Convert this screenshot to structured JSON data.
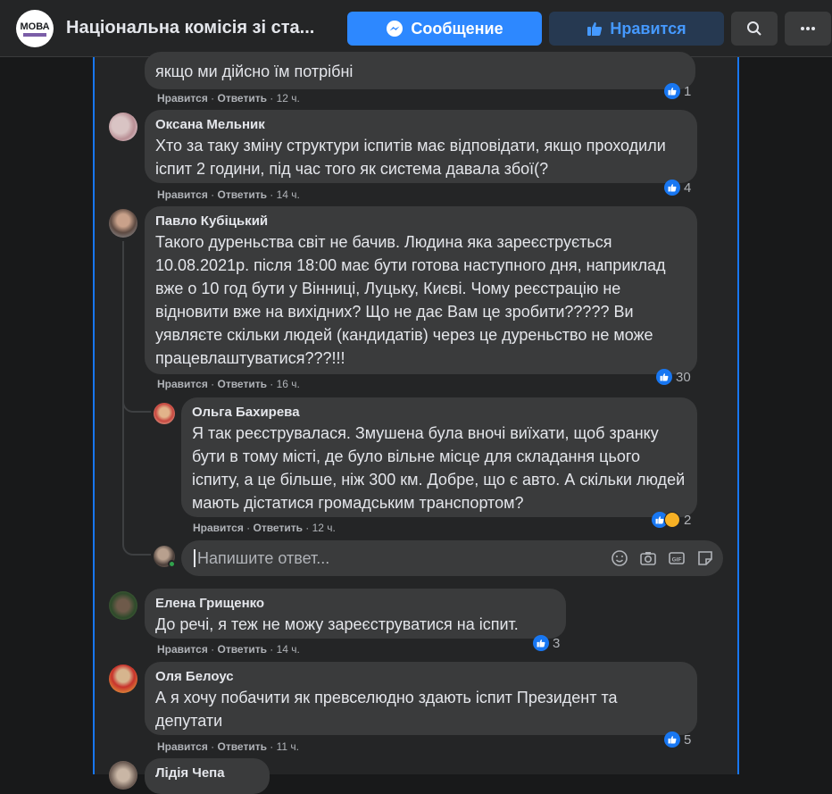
{
  "header": {
    "logo_text": "МОВА",
    "title": "Національна комісія зі ста...",
    "message_label": "Сообщение",
    "like_label": "Нравится"
  },
  "colors": {
    "accent": "#2d88ff",
    "bubble": "#3a3b3c",
    "background": "#242526"
  },
  "comments": [
    {
      "author": "",
      "text": "якщо ми дійсно їм потрібні",
      "like": "Нравится",
      "reply": "Ответить",
      "time": "12 ч.",
      "reactions": "1"
    },
    {
      "author": "Оксана Мельник",
      "text": "Хто за таку зміну структури іспитів має відповідати, якщо проходили іспит 2 години, під час того як система давала збої(?",
      "like": "Нравится",
      "reply": "Ответить",
      "time": "14 ч.",
      "reactions": "4"
    },
    {
      "author": "Павло Кубіцький",
      "text": "Такого дуреньства світ не бачив. Людина яка зареєструється 10.08.2021р. після 18:00 має бути готова наступного дня, наприклад вже о 10 год бути у Вінниці, Луцьку, Києві. Чому реєстрацію не відновити вже на вихідних? Що не дає Вам це зробити????? Ви уявляєте скільки людей (кандидатів) через це дуреньство не може працевлаштуватися???!!!",
      "like": "Нравится",
      "reply": "Ответить",
      "time": "16 ч.",
      "reactions": "30"
    },
    {
      "author": "Ольга Бахирева",
      "text": "Я так реєструвалася. Змушена була вночі виїхати, щоб зранку бути в тому місті, де було вільне місце для складання цього іспиту, а це більше, ніж 300 км. Добре, що є авто. А скільки людей мають дістатися громадським транспортом?",
      "like": "Нравится",
      "reply": "Ответить",
      "time": "12 ч.",
      "reactions": "2"
    },
    {
      "author": "Елена Грищенко",
      "text": "До речі, я теж не можу зареєструватися на іспит.",
      "like": "Нравится",
      "reply": "Ответить",
      "time": "14 ч.",
      "reactions": "3"
    },
    {
      "author": "Оля Белоус",
      "text": "А я хочу побачити як превселюдно здають іспит Президент та депутати",
      "like": "Нравится",
      "reply": "Ответить",
      "time": "11 ч.",
      "reactions": "5"
    },
    {
      "author": "Лідія Чепа"
    }
  ],
  "reply_box": {
    "placeholder": "Напишите ответ..."
  }
}
